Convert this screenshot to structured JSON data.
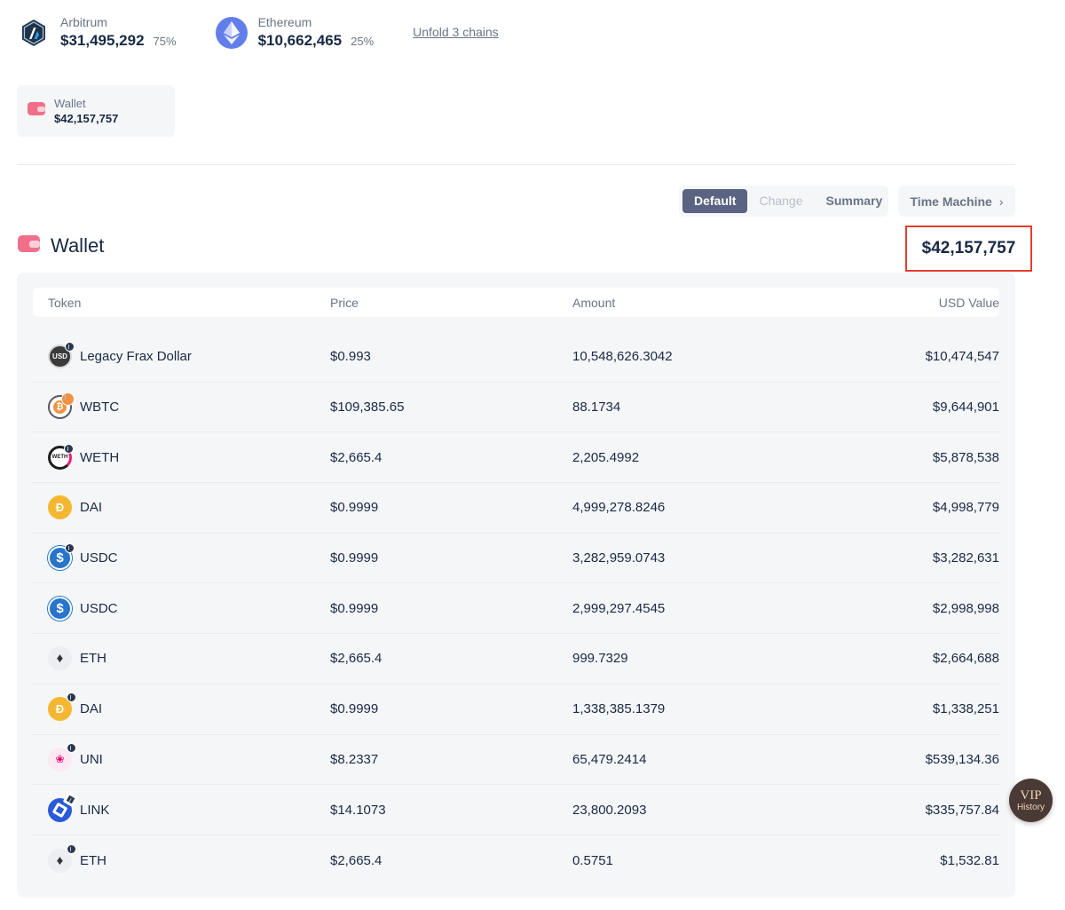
{
  "chains": [
    {
      "name": "Arbitrum",
      "value": "$31,495,292",
      "percent": "75%",
      "icon": "arbitrum-icon"
    },
    {
      "name": "Ethereum",
      "value": "$10,662,465",
      "percent": "25%",
      "icon": "ethereum-icon"
    }
  ],
  "unfold_label": "Unfold 3 chains",
  "wallet_card": {
    "label": "Wallet",
    "value": "$42,157,757",
    "icon": "wallet-icon"
  },
  "view_modes": {
    "default": "Default",
    "change": "Change",
    "summary": "Summary",
    "selected": "Default"
  },
  "time_machine": {
    "label": "Time Machine",
    "icon": "chevron-right-icon"
  },
  "section": {
    "title": "Wallet",
    "total": "$42,157,757",
    "highlight_color": "#e0402e"
  },
  "table": {
    "columns": {
      "token": "Token",
      "price": "Price",
      "amount": "Amount",
      "usd_value": "USD Value"
    },
    "rows": [
      {
        "token": "Legacy Frax Dollar",
        "price": "$0.993",
        "amount": "10,548,626.3042",
        "usd_value": "$10,474,547",
        "icon": "frax-usd-icon",
        "badge": true
      },
      {
        "token": "WBTC",
        "price": "$109,385.65",
        "amount": "88.1734",
        "usd_value": "$9,644,901",
        "icon": "wbtc-icon",
        "badge": true
      },
      {
        "token": "WETH",
        "price": "$2,665.4",
        "amount": "2,205.4992",
        "usd_value": "$5,878,538",
        "icon": "weth-icon",
        "badge": true
      },
      {
        "token": "DAI",
        "price": "$0.9999",
        "amount": "4,999,278.8246",
        "usd_value": "$4,998,779",
        "icon": "dai-icon",
        "badge": false
      },
      {
        "token": "USDC",
        "price": "$0.9999",
        "amount": "3,282,959.0743",
        "usd_value": "$3,282,631",
        "icon": "usdc-icon",
        "badge": true
      },
      {
        "token": "USDC",
        "price": "$0.9999",
        "amount": "2,999,297.4545",
        "usd_value": "$2,998,998",
        "icon": "usdc-icon",
        "badge": false
      },
      {
        "token": "ETH",
        "price": "$2,665.4",
        "amount": "999.7329",
        "usd_value": "$2,664,688",
        "icon": "eth-icon",
        "badge": false
      },
      {
        "token": "DAI",
        "price": "$0.9999",
        "amount": "1,338,385.1379",
        "usd_value": "$1,338,251",
        "icon": "dai-icon",
        "badge": true
      },
      {
        "token": "UNI",
        "price": "$8.2337",
        "amount": "65,479.2414",
        "usd_value": "$539,134.36",
        "icon": "uni-icon",
        "badge": true
      },
      {
        "token": "LINK",
        "price": "$14.1073",
        "amount": "23,800.2093",
        "usd_value": "$335,757.84",
        "icon": "chainlink-icon",
        "badge": true
      },
      {
        "token": "ETH",
        "price": "$2,665.4",
        "amount": "0.5751",
        "usd_value": "$1,532.81",
        "icon": "eth-icon",
        "badge": true
      }
    ]
  },
  "vip_button": {
    "title": "VIP",
    "subtitle": "History"
  }
}
